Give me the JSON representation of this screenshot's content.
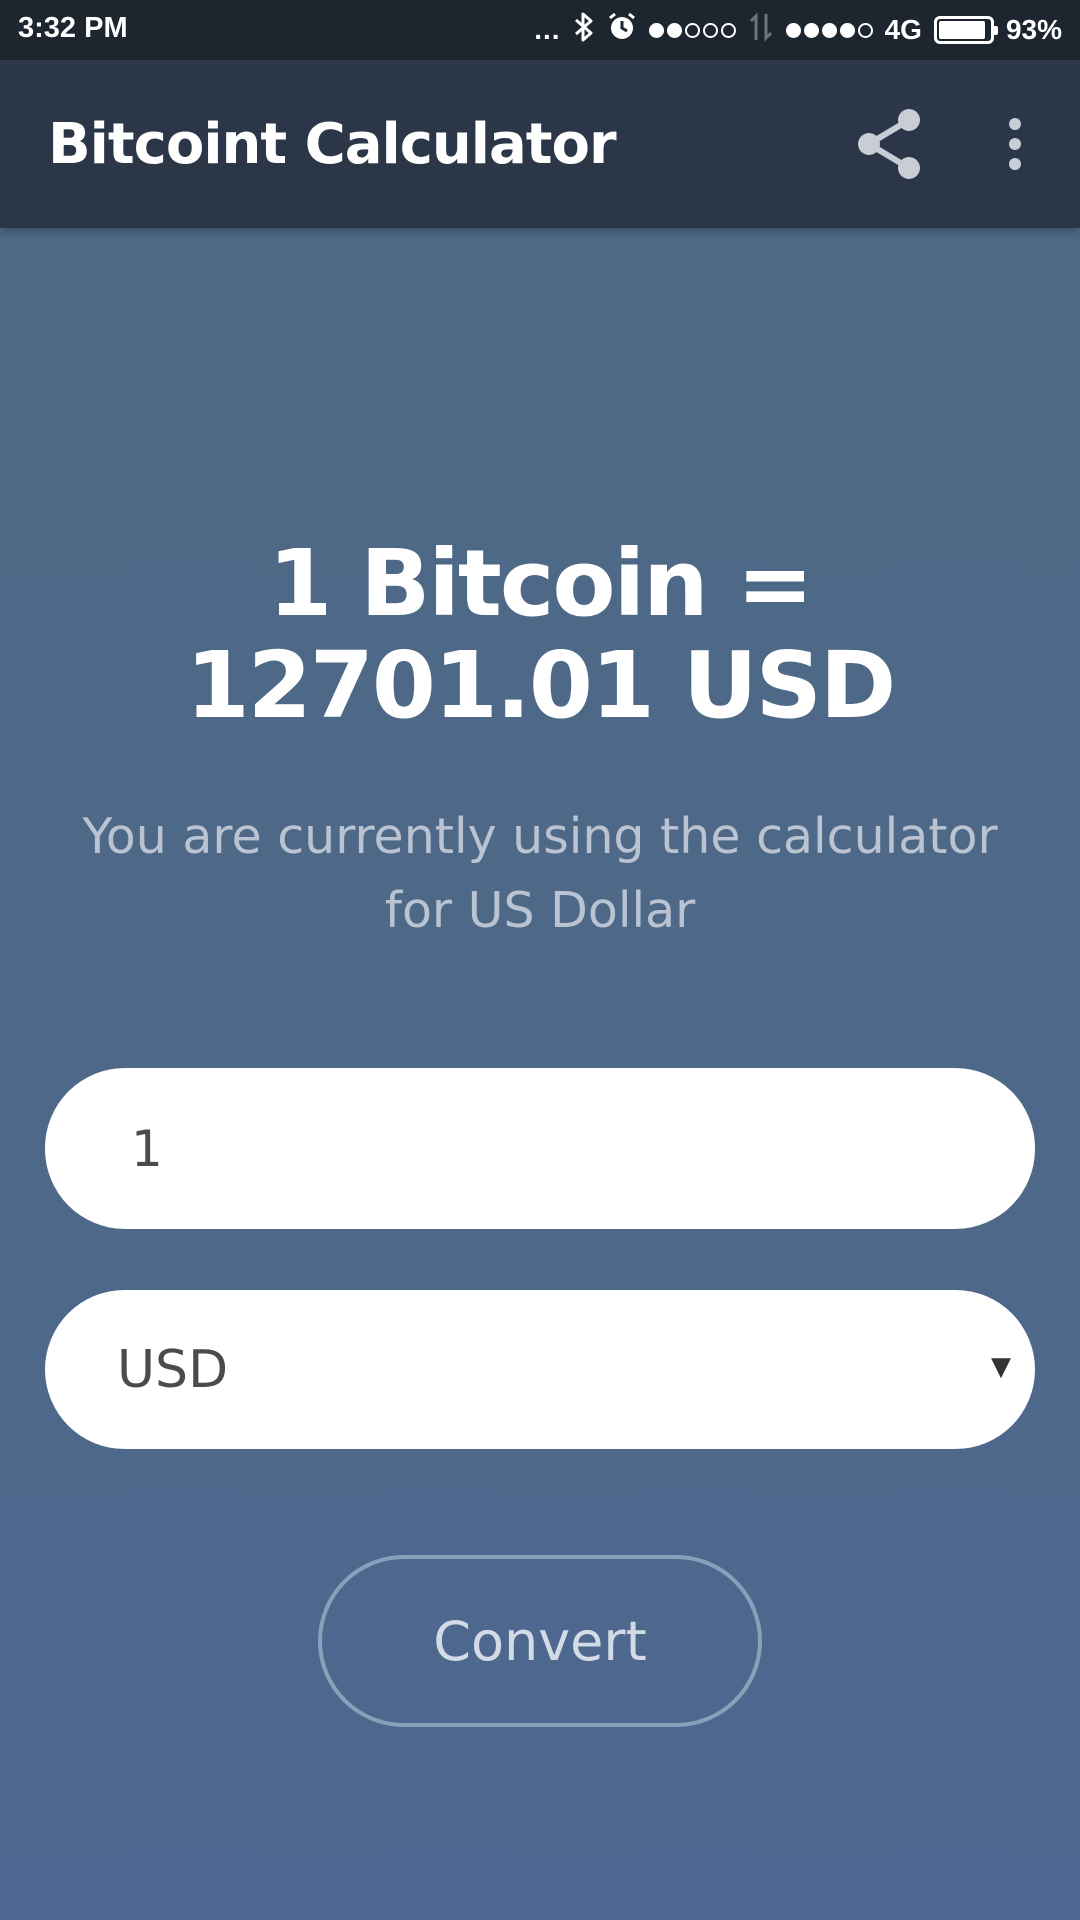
{
  "status_bar": {
    "time": "3:32 PM",
    "more_dots": "...",
    "network_type": "4G",
    "battery_percent": "93%",
    "battery_level": 0.93,
    "signal1_filled": 2,
    "signal1_total": 5,
    "signal2_filled": 4,
    "signal2_total": 5,
    "icons": [
      "bluetooth-icon",
      "alarm-icon",
      "data-transfer-icon",
      "battery-icon"
    ]
  },
  "app_bar": {
    "title": "Bitcoint Calculator",
    "icons": [
      "share-icon",
      "more-vert-icon"
    ]
  },
  "main": {
    "rate_line1": "1 Bitcoin =",
    "rate_line2": "12701.01 USD",
    "subtitle": "You are currently using the calculator for US Dollar",
    "amount_value": "1",
    "currency_selected": "USD",
    "convert_label": "Convert"
  },
  "colors": {
    "app_bar": "#2c3849",
    "status_bar": "#1d252f",
    "background": "#4f6a84",
    "subtitle_text": "#b9c3d1",
    "button_border": "#8aa0ba"
  }
}
